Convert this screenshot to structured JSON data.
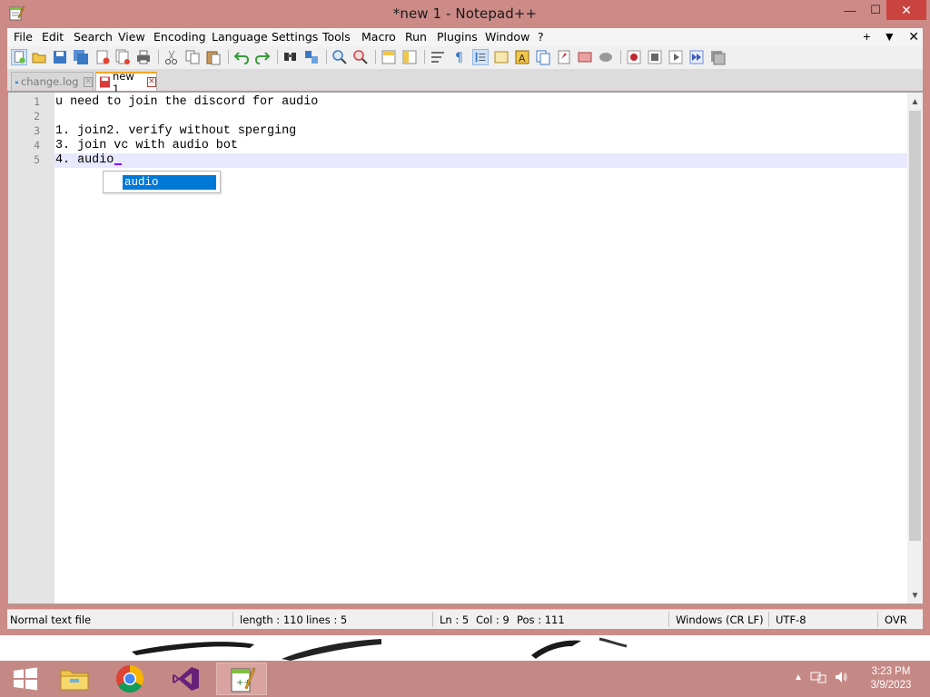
{
  "window": {
    "title": "*new 1 - Notepad++",
    "caption_buttons": {
      "minimize": "—",
      "maximize": "☐",
      "close": "✕"
    }
  },
  "menu": {
    "items": [
      "File",
      "Edit",
      "Search",
      "View",
      "Encoding",
      "Language",
      "Settings",
      "Tools",
      "Macro",
      "Run",
      "Plugins",
      "Window",
      "?"
    ],
    "right": {
      "add": "+",
      "dropdown": "▼",
      "close": "✕"
    }
  },
  "toolbar": {
    "icons": [
      "new-file-icon",
      "open-file-icon",
      "save-icon",
      "save-all-icon",
      "close-icon",
      "close-all-icon",
      "print-icon",
      "cut-icon",
      "copy-icon",
      "paste-icon",
      "undo-icon",
      "redo-icon",
      "find-icon",
      "replace-icon",
      "zoom-in-icon",
      "zoom-out-icon",
      "sync-vertical-icon",
      "sync-horizontal-icon",
      "word-wrap-icon",
      "show-all-chars-icon",
      "indent-guide-icon",
      "user-lang-icon",
      "doc-map-icon",
      "function-list-icon",
      "folder-workspace-icon",
      "monitoring-icon",
      "record-macro-icon",
      "stop-macro-icon",
      "play-macro-icon",
      "run-macro-multiple-icon",
      "save-macro-icon"
    ]
  },
  "tabs": [
    {
      "label": "change.log",
      "active": false,
      "close": "✕"
    },
    {
      "label": "new 1",
      "active": true,
      "close": "✕"
    }
  ],
  "editor": {
    "line_numbers": [
      "1",
      "2",
      "3",
      "4",
      "5"
    ],
    "lines": [
      "u need to join the discord for audio",
      "",
      "1. join2. verify without sperging",
      "3. join vc with audio bot",
      "4. audio"
    ],
    "current_line": 5,
    "autocomplete": {
      "suggestion": "audio"
    },
    "scroll": {
      "up": "▲",
      "down": "▼"
    }
  },
  "statusbar": {
    "file_type": "Normal text file",
    "length": "length : 110",
    "lines": "lines : 5",
    "ln": "Ln : 5",
    "col": "Col : 9",
    "pos": "Pos : 111",
    "eol": "Windows (CR LF)",
    "encoding": "UTF-8",
    "mode": "OVR"
  },
  "taskbar": {
    "apps": [
      "start-button",
      "file-explorer",
      "chrome",
      "visual-studio",
      "notepad-plus-plus"
    ],
    "clock": {
      "time": "3:23 PM",
      "date": "3/9/2023"
    }
  },
  "colors": {
    "window_frame": "#cd8b87",
    "taskbar": "#c58985",
    "current_line": "#e8e8ff",
    "caret": "#8000ff",
    "selection": "#0078d7"
  }
}
